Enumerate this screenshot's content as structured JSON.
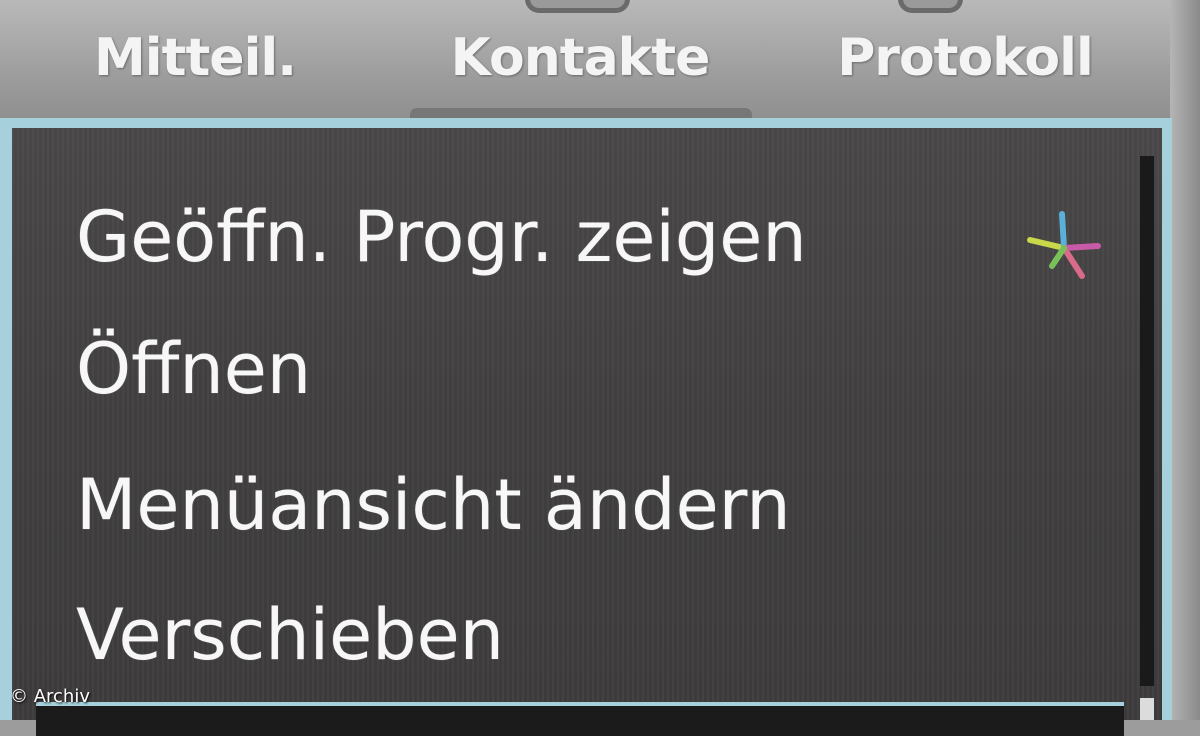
{
  "tabs": [
    {
      "label": "Mitteil."
    },
    {
      "label": "Kontakte",
      "active": true
    },
    {
      "label": "Protokoll"
    }
  ],
  "menu": {
    "items": [
      {
        "label": "Geöffn. Progr. zeigen"
      },
      {
        "label": "Öffnen"
      },
      {
        "label": "Menüansicht ändern"
      },
      {
        "label": "Verschieben"
      }
    ]
  },
  "icons": {
    "task_switcher": "multicolor-arrows-icon"
  },
  "colors": {
    "menu_background": "#444242",
    "menu_border": "#a6d0db",
    "text": "#f7f7f7"
  },
  "credit": "© Archiv"
}
